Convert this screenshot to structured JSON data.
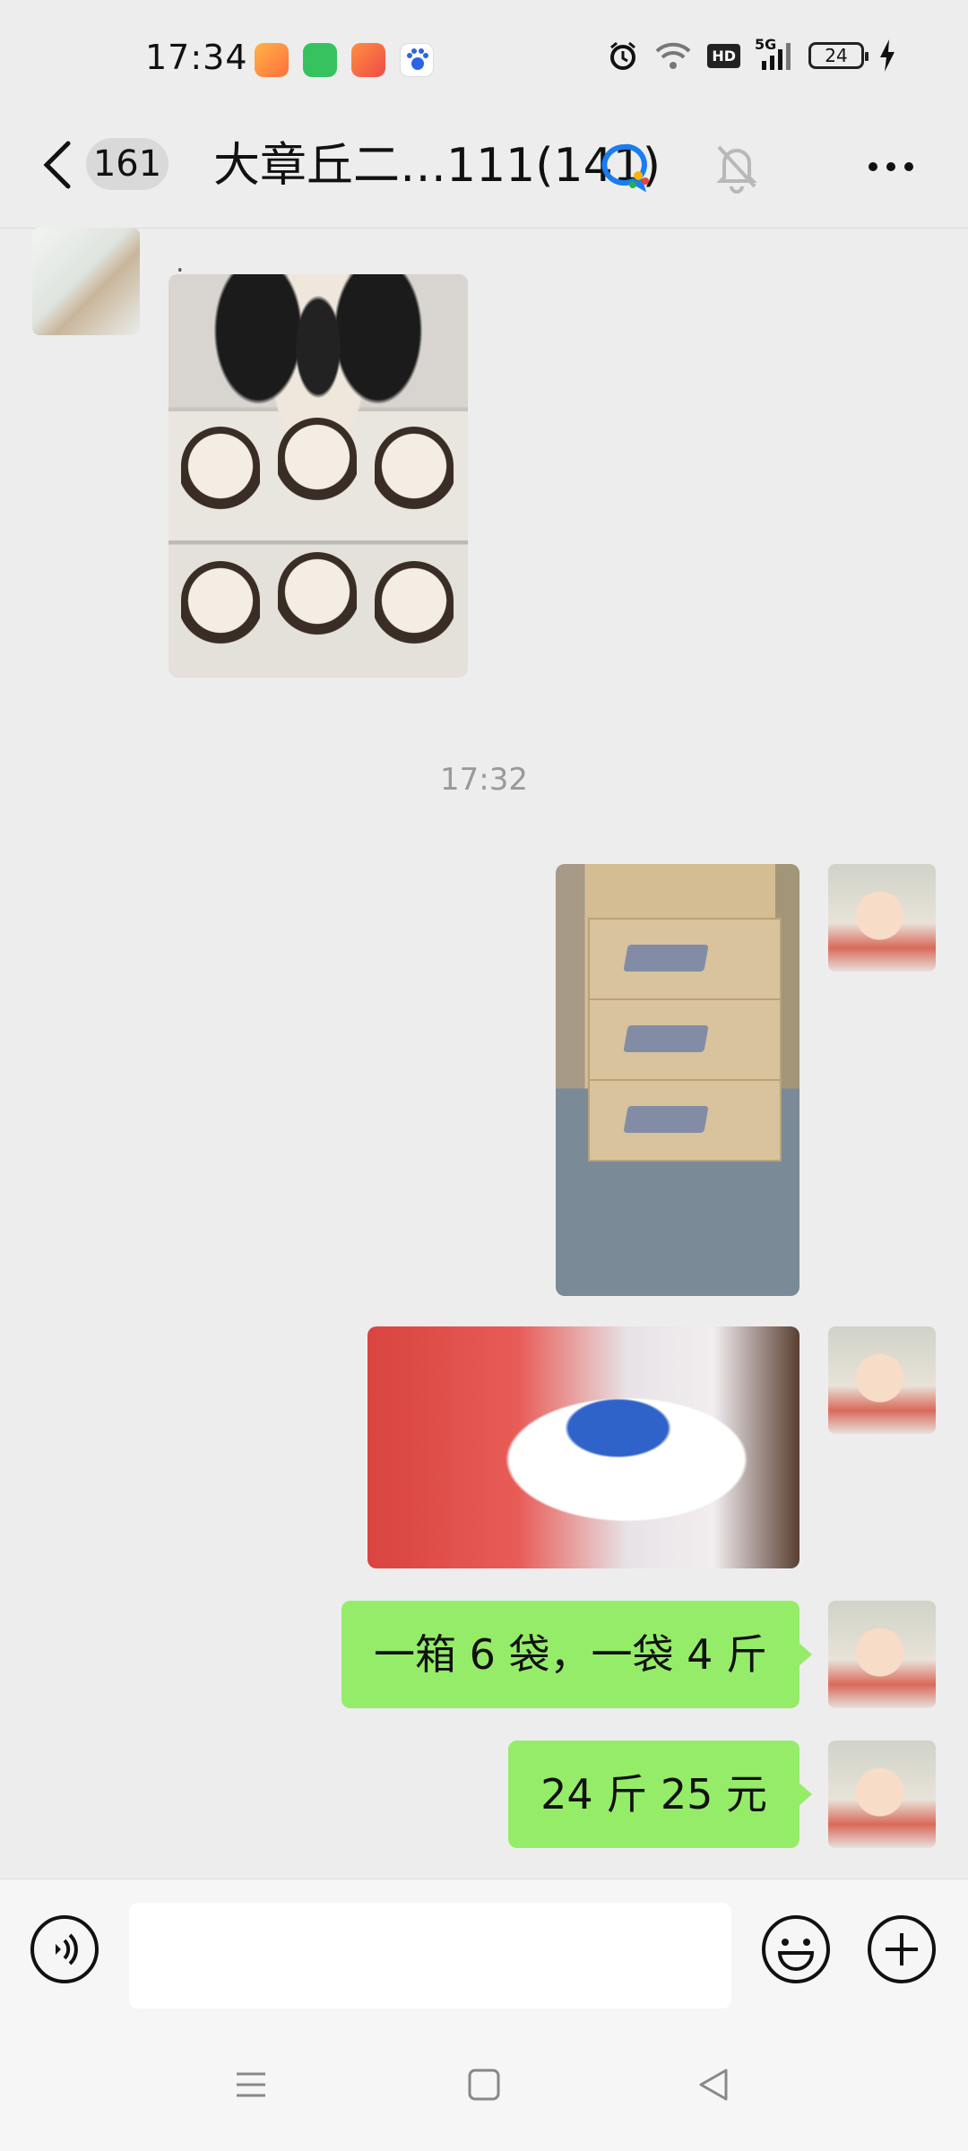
{
  "status_bar": {
    "time": "17:34",
    "network": "5G",
    "hd": "HD",
    "battery": "24",
    "icons": [
      "video-app-icon",
      "message-app-icon",
      "shopping-app-icon",
      "baidu-icon",
      "alarm-icon",
      "wifi-icon",
      "hd-icon",
      "signal-icon",
      "battery-icon",
      "charging-icon"
    ]
  },
  "header": {
    "unread_count": "161",
    "title": "大章丘二…111(141)",
    "icons": [
      "back-icon",
      "wecom-icon",
      "mute-bell-icon",
      "more-icon"
    ]
  },
  "messages": [
    {
      "side": "left",
      "type": "image",
      "sender_name": ".",
      "content": "puppies-photo"
    },
    {
      "type": "timestamp",
      "text": "17:32"
    },
    {
      "side": "right",
      "type": "image",
      "content": "boxes-photo"
    },
    {
      "side": "right",
      "type": "image",
      "content": "detergent-bag-photo"
    },
    {
      "side": "right",
      "type": "text",
      "text": "一箱 6 袋，一袋 4 斤"
    },
    {
      "side": "right",
      "type": "text",
      "text": "24 斤 25 元"
    }
  ],
  "input_bar": {
    "value": "",
    "placeholder": "",
    "icons": [
      "voice-icon",
      "emoji-icon",
      "plus-icon"
    ]
  },
  "nav_bar": {
    "icons": [
      "menu-icon",
      "home-icon",
      "back-triangle-icon"
    ]
  },
  "colors": {
    "background": "#ededed",
    "bubble_self": "#95ec69",
    "header_bg": "#ededed",
    "wecom_blue": "#1a7df0"
  }
}
